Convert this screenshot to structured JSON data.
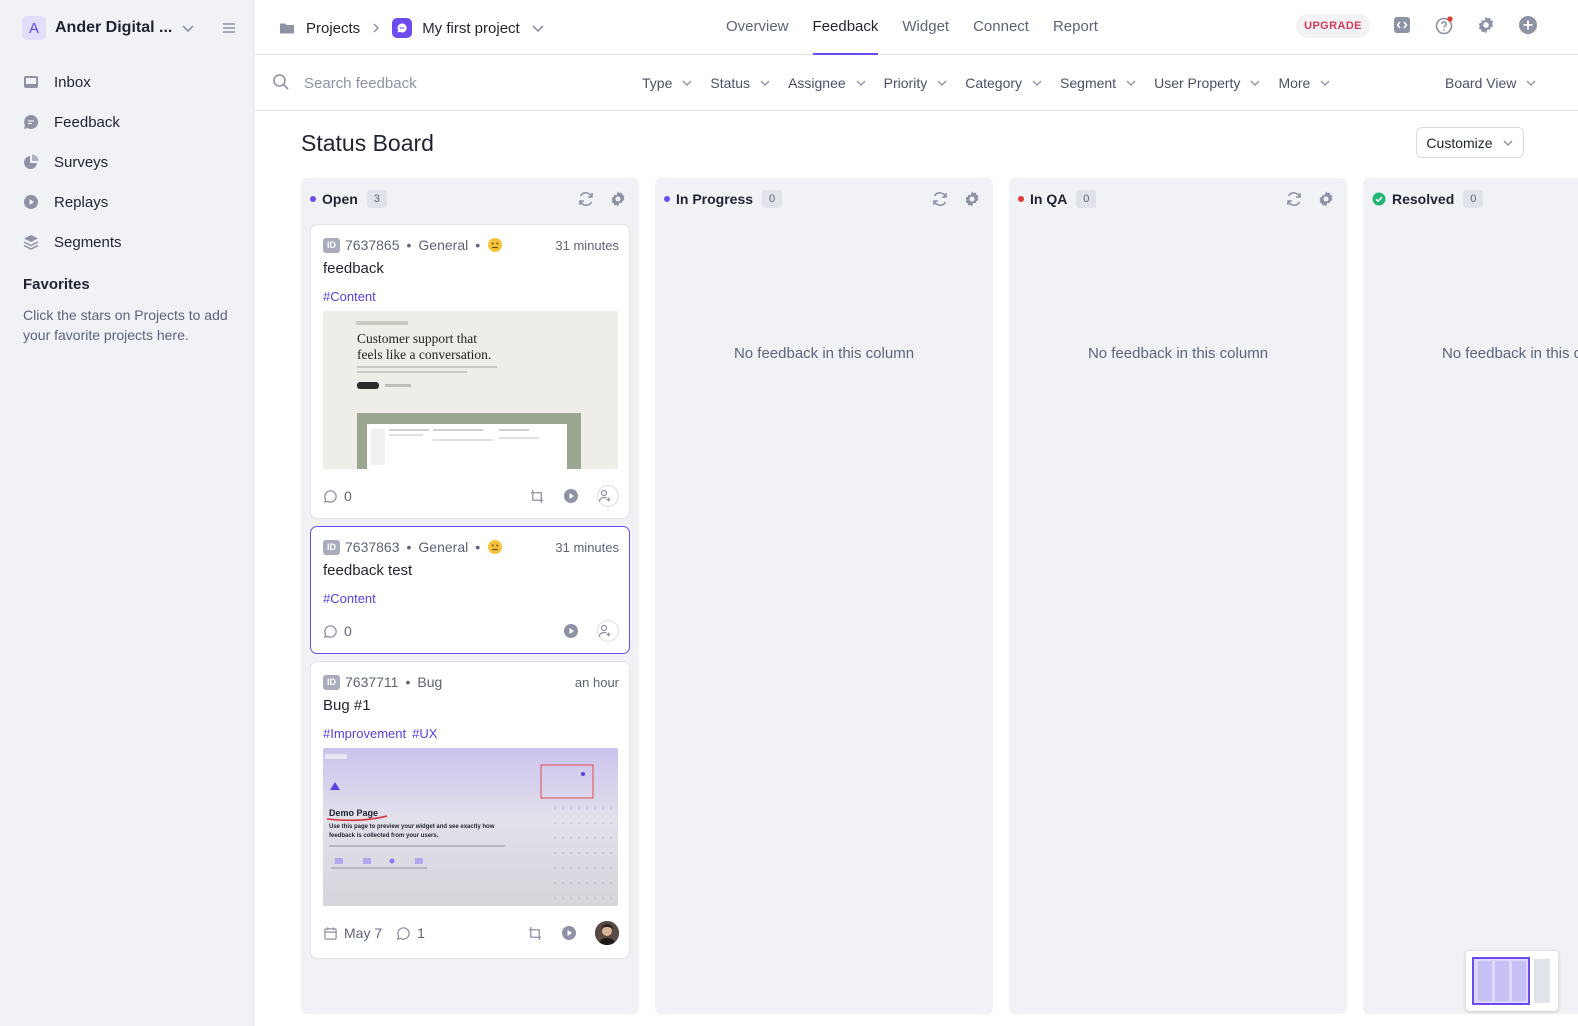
{
  "workspace": {
    "initial": "A",
    "name": "Ander Digital ..."
  },
  "sidebar": {
    "items": [
      {
        "label": "Inbox",
        "icon": "inbox-icon"
      },
      {
        "label": "Feedback",
        "icon": "chat-bubble-icon"
      },
      {
        "label": "Surveys",
        "icon": "pie-chart-icon"
      },
      {
        "label": "Replays",
        "icon": "play-circle-icon"
      },
      {
        "label": "Segments",
        "icon": "layers-icon"
      }
    ],
    "favorites_title": "Favorites",
    "favorites_text": "Click the stars on Projects to add your favorite projects here."
  },
  "header": {
    "breadcrumb_root": "Projects",
    "project_name": "My first project",
    "tabs": [
      "Overview",
      "Feedback",
      "Widget",
      "Connect",
      "Report"
    ],
    "active_tab": "Feedback",
    "upgrade_label": "UPGRADE"
  },
  "filters": {
    "search_placeholder": "Search feedback",
    "items": [
      "Type",
      "Status",
      "Assignee",
      "Priority",
      "Category",
      "Segment",
      "User Property",
      "More"
    ],
    "view_label": "Board View"
  },
  "board": {
    "title": "Status Board",
    "customize_label": "Customize",
    "empty_text": "No feedback in this column",
    "columns": [
      {
        "name": "Open",
        "count": "3",
        "color": "#6c4cf1"
      },
      {
        "name": "In Progress",
        "count": "0",
        "color": "#6c4cf1"
      },
      {
        "name": "In QA",
        "count": "0",
        "color": "#e53935"
      },
      {
        "name": "Resolved",
        "count": "0",
        "color": "#22b573"
      }
    ],
    "cards": [
      {
        "id": "7637865",
        "category": "General",
        "sentiment": "neutral-face",
        "time": "31 minutes",
        "title": "feedback",
        "tags": [
          "#Content"
        ],
        "comments": "0"
      },
      {
        "id": "7637863",
        "category": "General",
        "sentiment": "neutral-face",
        "time": "31 minutes",
        "title": "feedback test",
        "tags": [
          "#Content"
        ],
        "comments": "0"
      },
      {
        "id": "7637711",
        "category": "Bug",
        "time": "an hour",
        "title": "Bug #1",
        "tags": [
          "#Improvement",
          "#UX"
        ],
        "due": "May 7",
        "comments": "1"
      }
    ]
  },
  "thumb1": {
    "headline_line1": "Customer support that",
    "headline_line2": "feels like a conversation."
  },
  "thumb3": {
    "title": "Demo Page",
    "subtitle_line1": "Use this page to preview your widget and see exactly how",
    "subtitle_line2": "feedback is collected from your users."
  },
  "colors": {
    "accent": "#6c4cf1",
    "upgrade_text": "#d23a5a"
  }
}
